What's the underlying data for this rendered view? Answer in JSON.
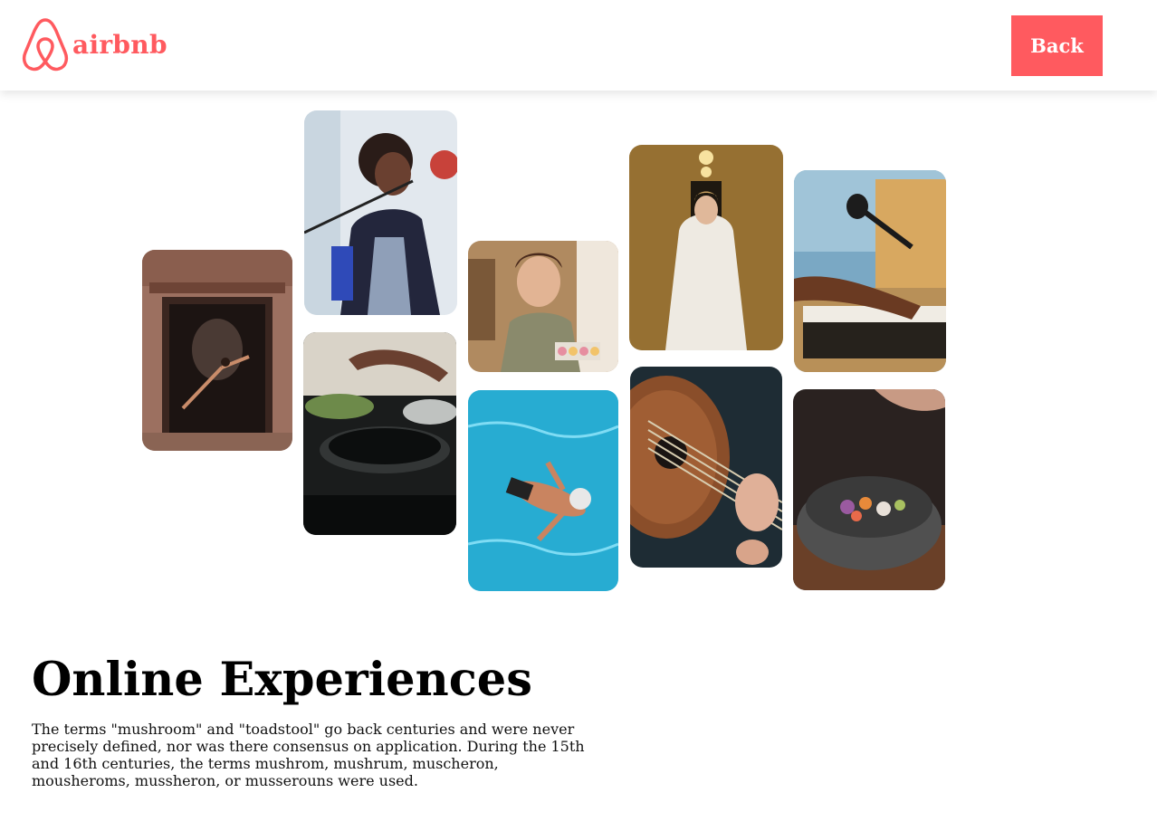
{
  "header": {
    "brand": "airbnb",
    "logo_icon": "airbnb-logo-icon",
    "back_label": "Back",
    "accent_color": "#ff5a5f"
  },
  "gallery": {
    "photos": [
      {
        "name": "dancer-photo",
        "subject": "dancer leaping in ornate doorway"
      },
      {
        "name": "singer-photo",
        "subject": "singer performing at microphone"
      },
      {
        "name": "cooking-photo",
        "subject": "hands cooking with frying pans"
      },
      {
        "name": "baker-photo",
        "subject": "woman holding a tray of macarons"
      },
      {
        "name": "swimmer-photo",
        "subject": "swimmer in blue pool"
      },
      {
        "name": "bride-photo",
        "subject": "bride in white dress in hallway"
      },
      {
        "name": "guitar-photo",
        "subject": "hand strumming acoustic guitar"
      },
      {
        "name": "keyboard-photo",
        "subject": "hands playing keyboard with microphone"
      },
      {
        "name": "food-bowl-photo",
        "subject": "seasoning a stone bowl of food"
      }
    ]
  },
  "main": {
    "title": "Online Experiences",
    "description": "The terms \"mushroom\" and \"toadstool\" go back centuries and were never precisely defined, nor was there consensus on application. During the 15th and 16th centuries, the terms mushrom, mushrum, muscheron, mousheroms, mussheron, or musserouns were used."
  }
}
